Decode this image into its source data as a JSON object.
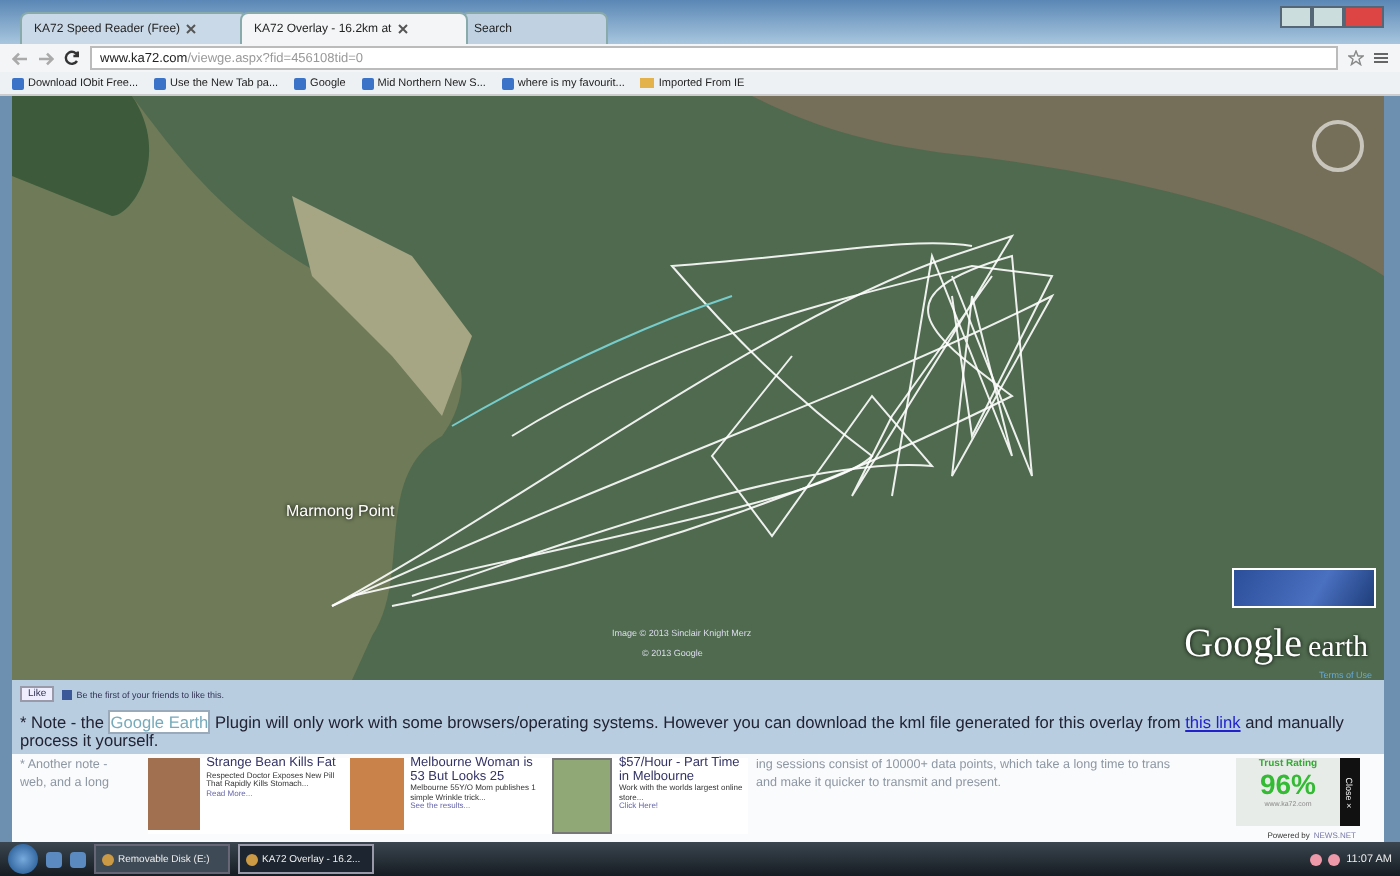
{
  "tabs": [
    {
      "label": "KA72 Speed Reader (Free)",
      "selected": false
    },
    {
      "label": "KA72 Overlay - 16.2km at",
      "selected": true
    },
    {
      "label": "Search",
      "selected": false
    }
  ],
  "address": {
    "domain": "www.ka72.com",
    "path": "/viewge.aspx?fid=456108tid=0"
  },
  "bookmarks": [
    "Download IObit Free...",
    "Use the New Tab pa...",
    "Google",
    "Mid Northern New S...",
    "where is my favourit...",
    "Imported From IE"
  ],
  "map": {
    "place_label": "Marmong Point",
    "credit": "Image © 2013 Sinclair Knight Merz",
    "copyright": "© 2013 Google",
    "brand_word_1": "Google",
    "brand_word_2": "earth",
    "terms": "Terms of Use"
  },
  "like": {
    "button": "Like",
    "text": "Be the first of your friends to like this."
  },
  "note": {
    "before": "* Note - the ",
    "highlight": "Google Earth",
    "middle": " Plugin will only work with some browsers/operating systems. However you can download the kml file generated for this overlay from ",
    "link": "this link",
    "after": " and manually process it yourself."
  },
  "hidden_note": {
    "left_1": "* Another note -",
    "left_2": "web, and a long",
    "right_1": "ing sessions consist of 10000+ data points, which take a long time to trans",
    "right_2": "and make it quicker to transmit and present."
  },
  "ads": [
    {
      "title": "Strange Bean Kills Fat",
      "body": "Respected Doctor Exposes New Pill That Rapidly Kills Stomach...",
      "more": "Read More..."
    },
    {
      "title": "Melbourne Woman is 53 But Looks 25",
      "body": "Melbourne 55Y/O Mom publishes 1 simple Wrinkle trick...",
      "more": "See the results..."
    },
    {
      "title": "$57/Hour - Part Time in Melbourne",
      "body": "Work with the worlds largest online store...",
      "more": "Click Here!"
    }
  ],
  "trust": {
    "heading": "Trust Rating",
    "value": "96%",
    "site": "www.ka72.com",
    "close": "Close ×",
    "powered_by": "Powered by",
    "network": "NEWS.NET"
  },
  "taskbar": {
    "items": [
      {
        "label": "Removable Disk (E:)",
        "selected": false
      },
      {
        "label": "KA72 Overlay - 16.2...",
        "selected": true
      }
    ],
    "clock": "11:07 AM"
  }
}
